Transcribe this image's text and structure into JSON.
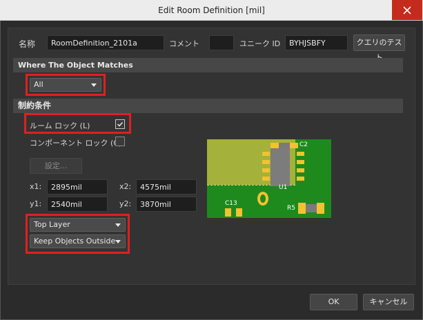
{
  "window": {
    "title": "Edit Room Definition [mil]"
  },
  "header": {
    "name_label": "名称",
    "name_value": "RoomDefinition_2101a",
    "comment_label": "コメント",
    "comment_value": "",
    "uid_label": "ユニーク ID",
    "uid_value": "BYHJSBFY",
    "test_query_label": "クエリのテスト"
  },
  "where_section": {
    "title": "Where The Object Matches",
    "dropdown_value": "All"
  },
  "constraints_section": {
    "title": "制約条件",
    "room_lock_label": "ルーム ロック (L)",
    "room_lock_checked": true,
    "component_lock_label": "コンポーネント ロック (C)",
    "component_lock_checked": false,
    "settings_label": "設定...",
    "x1_label": "x1:",
    "x1_value": "2895mil",
    "x2_label": "x2:",
    "x2_value": "4575mil",
    "y1_label": "y1:",
    "y1_value": "2540mil",
    "y2_label": "y2:",
    "y2_value": "3870mil",
    "layer_value": "Top Layer",
    "objects_value": "Keep Objects Outside"
  },
  "preview": {
    "labels": {
      "c2": "C2",
      "u1": "U1",
      "c13": "C13",
      "r5": "R5"
    }
  },
  "footer": {
    "ok_label": "OK",
    "cancel_label": "キャンセル"
  },
  "colors": {
    "highlight": "#e02020",
    "board": "#1e8a1e",
    "room": "#a4b13a",
    "pad": "#f2c230",
    "close_button": "#c42b1c"
  }
}
